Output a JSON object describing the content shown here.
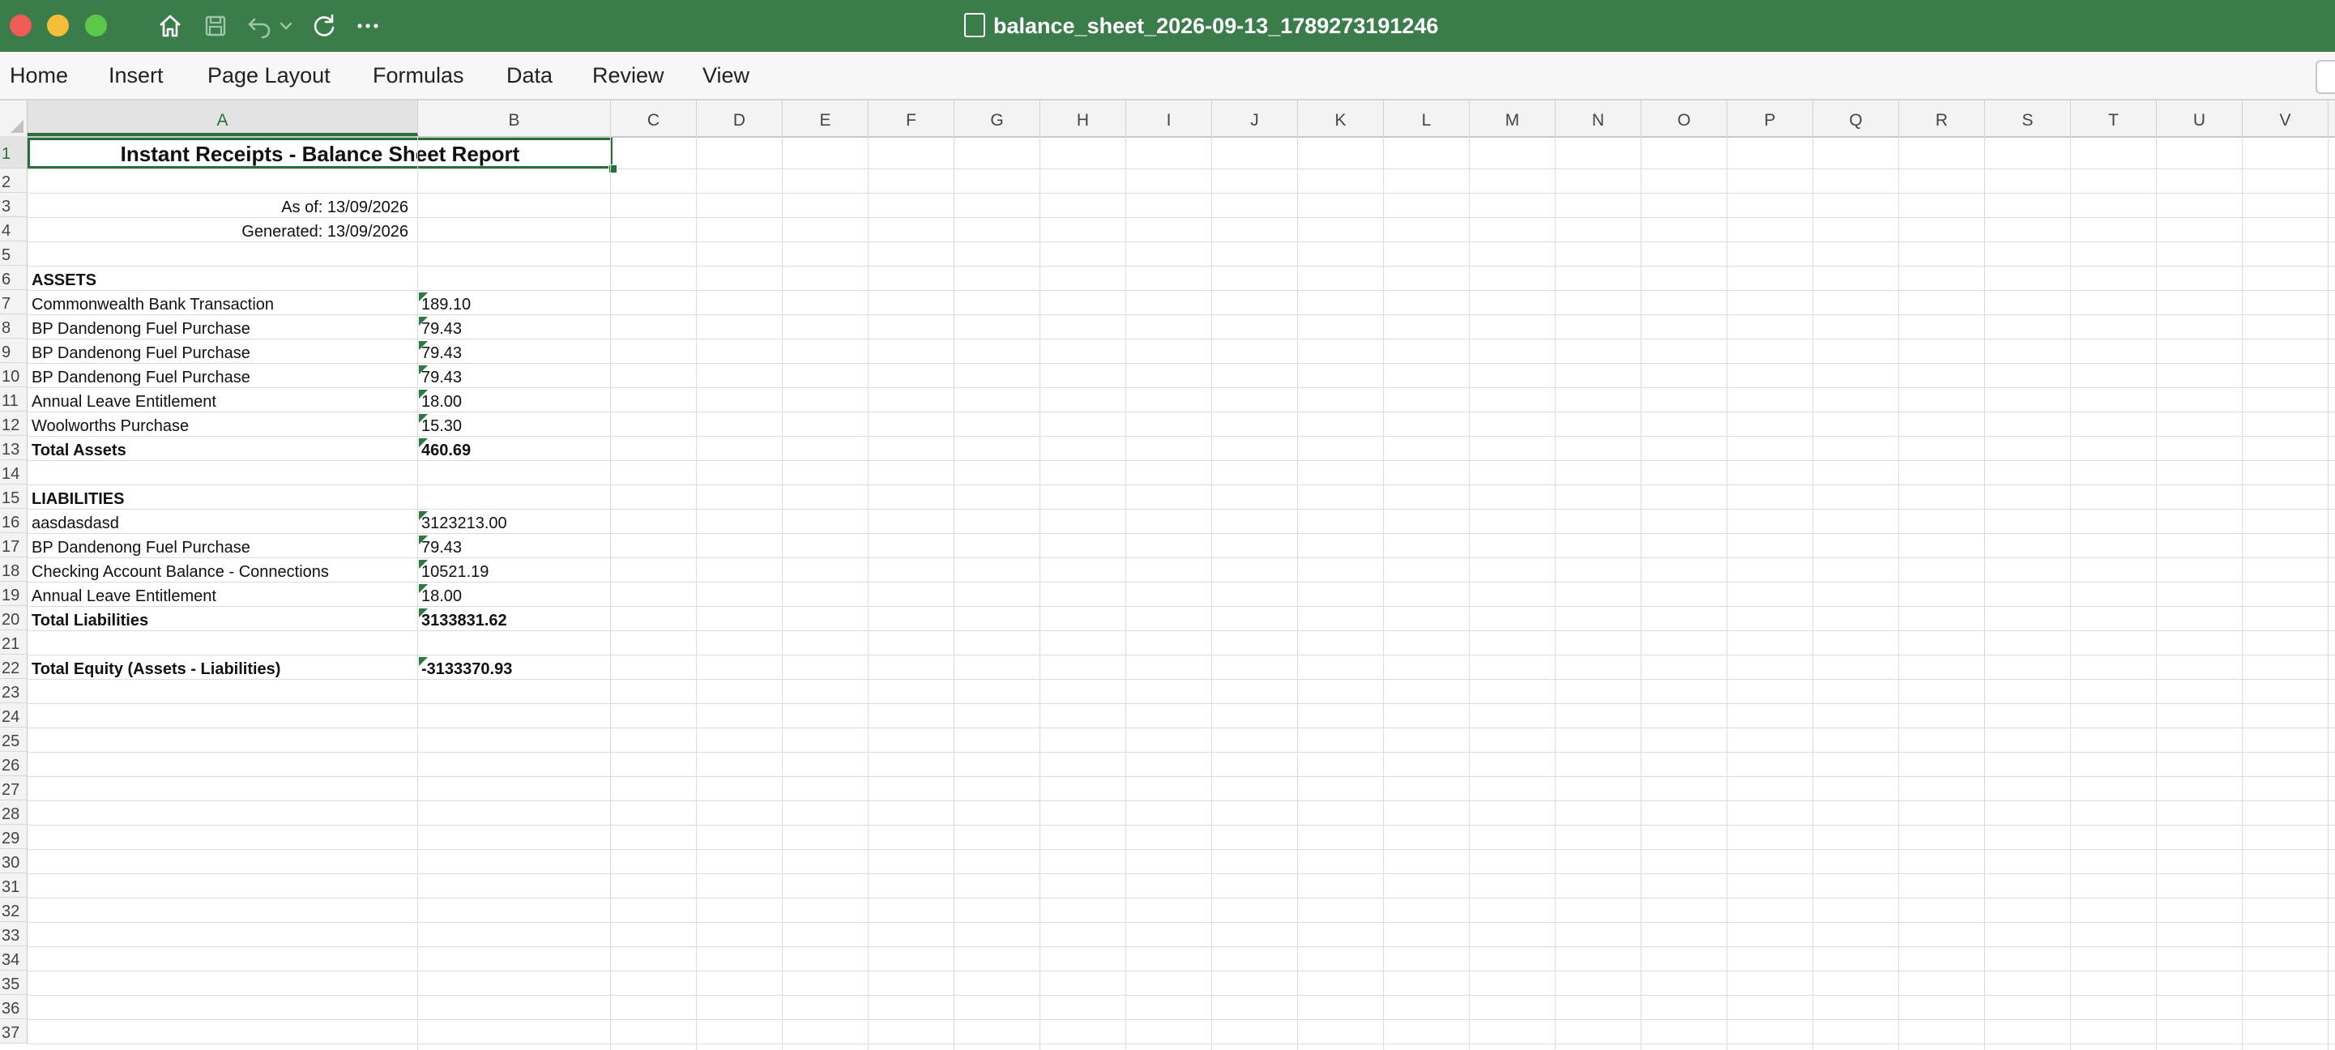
{
  "window": {
    "title": "balance_sheet_2026-09-13_1789273191246",
    "toolbar_icons": [
      "home-icon",
      "save-icon",
      "undo-icon",
      "chevron-down-icon",
      "redo-icon",
      "more-icon"
    ]
  },
  "ribbon": {
    "tabs": [
      {
        "label": "Home"
      },
      {
        "label": "Insert"
      },
      {
        "label": "Page Layout"
      },
      {
        "label": "Formulas"
      },
      {
        "label": "Data"
      },
      {
        "label": "Review"
      },
      {
        "label": "View"
      }
    ]
  },
  "sheet": {
    "columns": [
      "A",
      "B",
      "C",
      "D",
      "E",
      "F",
      "G",
      "H",
      "I",
      "J",
      "K",
      "L",
      "M",
      "N",
      "O",
      "P",
      "Q",
      "R",
      "S",
      "T",
      "U",
      "V"
    ],
    "selected_column": "A",
    "selected_row": 1,
    "rows": [
      "1",
      "2",
      "3",
      "4",
      "5",
      "6",
      "7",
      "8",
      "9",
      "10",
      "11",
      "12",
      "13",
      "14",
      "15",
      "16",
      "17",
      "18",
      "19",
      "20",
      "21",
      "22",
      "23",
      "24",
      "25",
      "26",
      "27",
      "28",
      "29",
      "30",
      "31",
      "32",
      "33",
      "34",
      "35",
      "36",
      "37"
    ],
    "title_cell": "Instant Receipts - Balance Sheet Report",
    "as_of": "As of: 13/09/2026",
    "generated": "Generated: 13/09/2026",
    "assets_header": "ASSETS",
    "assets": [
      {
        "label": "Commonwealth Bank Transaction",
        "value": "189.10"
      },
      {
        "label": "BP Dandenong Fuel Purchase",
        "value": "79.43"
      },
      {
        "label": "BP Dandenong Fuel Purchase",
        "value": "79.43"
      },
      {
        "label": "BP Dandenong Fuel Purchase",
        "value": "79.43"
      },
      {
        "label": "Annual Leave Entitlement",
        "value": "18.00"
      },
      {
        "label": "Woolworths Purchase",
        "value": "15.30"
      }
    ],
    "total_assets": {
      "label": "Total Assets",
      "value": "460.69"
    },
    "liabilities_header": "LIABILITIES",
    "liabilities": [
      {
        "label": "aasdasdasd",
        "value": "3123213.00"
      },
      {
        "label": "BP Dandenong Fuel Purchase",
        "value": "79.43"
      },
      {
        "label": "Checking Account Balance - Connections",
        "value": "10521.19"
      },
      {
        "label": "Annual Leave Entitlement",
        "value": "18.00"
      }
    ],
    "total_liabilities": {
      "label": "Total Liabilities",
      "value": "3133831.62"
    },
    "total_equity": {
      "label": "Total Equity (Assets - Liabilities)",
      "value": "-3133370.93"
    }
  },
  "colors": {
    "titlebar": "#3a7d4a",
    "accent": "#2a6e3a"
  }
}
